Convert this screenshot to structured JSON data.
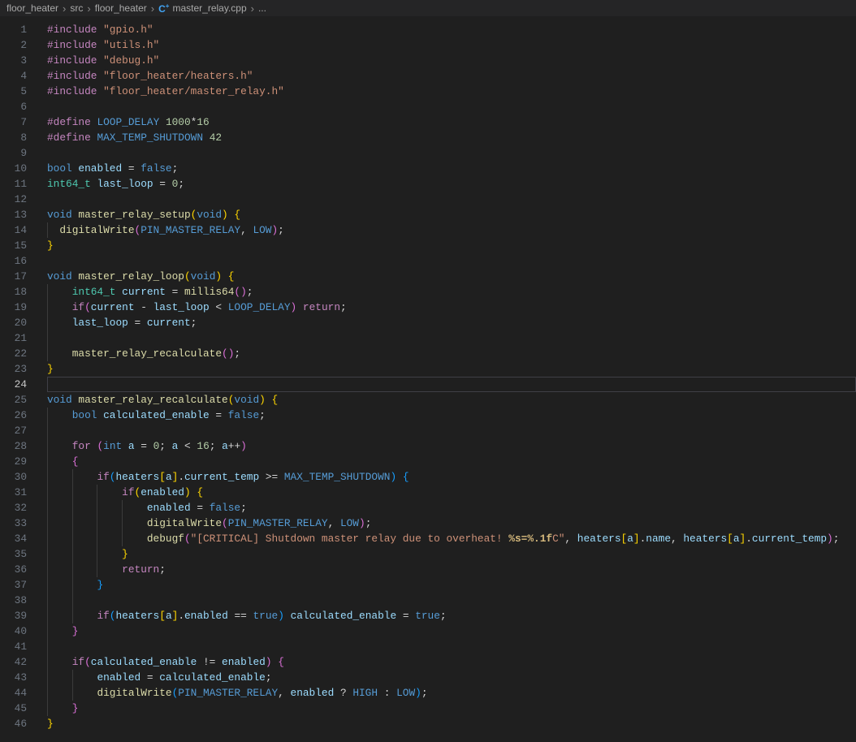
{
  "breadcrumb": {
    "items": [
      "floor_heater",
      "src",
      "floor_heater",
      "master_relay.cpp",
      "..."
    ],
    "separator": "›",
    "file_icon": "cpp-file-icon",
    "file_icon_glyph": "C",
    "file_icon_plus": "+"
  },
  "editor": {
    "file_language": "cpp",
    "active_line": 24,
    "colors": {
      "background": "#1f1f1f",
      "breadcrumb_background": "#252526",
      "line_number": "#6e7681",
      "line_number_active": "#c6c6c6",
      "current_line_border": "#3f3f46",
      "indent_guide": "#3b3b3b",
      "preprocessor_keyword": "#C586C0",
      "keyword_constant": "#569CD6",
      "type": "#4EC9B0",
      "function": "#DCDCAA",
      "variable": "#9CDCFE",
      "string": "#CE9178",
      "number": "#B5CEA8",
      "default_text": "#D4D4D4",
      "bracket_gold": "#FFD700",
      "bracket_pink": "#DA70D6",
      "bracket_blue": "#179FFF",
      "format_specifier": "#D7BA7D",
      "cpp_icon_blue": "#42a5f5"
    },
    "lines": [
      {
        "n": 1,
        "g": [],
        "t": [
          [
            "c",
            "#include"
          ],
          [
            "w",
            " "
          ],
          [
            "s",
            "\"gpio.h\""
          ]
        ]
      },
      {
        "n": 2,
        "g": [],
        "t": [
          [
            "c",
            "#include"
          ],
          [
            "w",
            " "
          ],
          [
            "s",
            "\"utils.h\""
          ]
        ]
      },
      {
        "n": 3,
        "g": [],
        "t": [
          [
            "c",
            "#include"
          ],
          [
            "w",
            " "
          ],
          [
            "s",
            "\"debug.h\""
          ]
        ]
      },
      {
        "n": 4,
        "g": [],
        "t": [
          [
            "c",
            "#include"
          ],
          [
            "w",
            " "
          ],
          [
            "s",
            "\"floor_heater/heaters.h\""
          ]
        ]
      },
      {
        "n": 5,
        "g": [],
        "t": [
          [
            "c",
            "#include"
          ],
          [
            "w",
            " "
          ],
          [
            "s",
            "\"floor_heater/master_relay.h\""
          ]
        ]
      },
      {
        "n": 6,
        "g": [],
        "t": []
      },
      {
        "n": 7,
        "g": [],
        "t": [
          [
            "c",
            "#define"
          ],
          [
            "w",
            " "
          ],
          [
            "k",
            "LOOP_DELAY"
          ],
          [
            "w",
            " "
          ],
          [
            "n",
            "1000"
          ],
          [
            "w",
            "*"
          ],
          [
            "n",
            "16"
          ]
        ]
      },
      {
        "n": 8,
        "g": [],
        "t": [
          [
            "c",
            "#define"
          ],
          [
            "w",
            " "
          ],
          [
            "k",
            "MAX_TEMP_SHUTDOWN"
          ],
          [
            "w",
            " "
          ],
          [
            "n",
            "42"
          ]
        ]
      },
      {
        "n": 9,
        "g": [],
        "t": []
      },
      {
        "n": 10,
        "g": [],
        "t": [
          [
            "k",
            "bool"
          ],
          [
            "w",
            " "
          ],
          [
            "v",
            "enabled"
          ],
          [
            "w",
            " = "
          ],
          [
            "k",
            "false"
          ],
          [
            "w",
            ";"
          ]
        ]
      },
      {
        "n": 11,
        "g": [],
        "t": [
          [
            "t",
            "int64_t"
          ],
          [
            "w",
            " "
          ],
          [
            "v",
            "last_loop"
          ],
          [
            "w",
            " = "
          ],
          [
            "n",
            "0"
          ],
          [
            "w",
            ";"
          ]
        ]
      },
      {
        "n": 12,
        "g": [],
        "t": []
      },
      {
        "n": 13,
        "g": [],
        "t": [
          [
            "k",
            "void"
          ],
          [
            "w",
            " "
          ],
          [
            "f",
            "master_relay_setup"
          ],
          [
            "b1",
            "("
          ],
          [
            "k",
            "void"
          ],
          [
            "b1",
            ")"
          ],
          [
            "w",
            " "
          ],
          [
            "b1",
            "{"
          ]
        ]
      },
      {
        "n": 14,
        "g": [
          0
        ],
        "t": [
          [
            "w",
            "  "
          ],
          [
            "f",
            "digitalWrite"
          ],
          [
            "b2",
            "("
          ],
          [
            "k",
            "PIN_MASTER_RELAY"
          ],
          [
            "w",
            ", "
          ],
          [
            "k",
            "LOW"
          ],
          [
            "b2",
            ")"
          ],
          [
            "w",
            ";"
          ]
        ]
      },
      {
        "n": 15,
        "g": [],
        "t": [
          [
            "b1",
            "}"
          ]
        ]
      },
      {
        "n": 16,
        "g": [],
        "t": []
      },
      {
        "n": 17,
        "g": [],
        "t": [
          [
            "k",
            "void"
          ],
          [
            "w",
            " "
          ],
          [
            "f",
            "master_relay_loop"
          ],
          [
            "b1",
            "("
          ],
          [
            "k",
            "void"
          ],
          [
            "b1",
            ")"
          ],
          [
            "w",
            " "
          ],
          [
            "b1",
            "{"
          ]
        ]
      },
      {
        "n": 18,
        "g": [
          0
        ],
        "t": [
          [
            "w",
            "    "
          ],
          [
            "t",
            "int64_t"
          ],
          [
            "w",
            " "
          ],
          [
            "v",
            "current"
          ],
          [
            "w",
            " = "
          ],
          [
            "f",
            "millis64"
          ],
          [
            "b2",
            "()"
          ],
          [
            "w",
            ";"
          ]
        ]
      },
      {
        "n": 19,
        "g": [
          0
        ],
        "t": [
          [
            "w",
            "    "
          ],
          [
            "c",
            "if"
          ],
          [
            "b2",
            "("
          ],
          [
            "v",
            "current"
          ],
          [
            "w",
            " - "
          ],
          [
            "v",
            "last_loop"
          ],
          [
            "w",
            " < "
          ],
          [
            "k",
            "LOOP_DELAY"
          ],
          [
            "b2",
            ")"
          ],
          [
            "w",
            " "
          ],
          [
            "c",
            "return"
          ],
          [
            "w",
            ";"
          ]
        ]
      },
      {
        "n": 20,
        "g": [
          0
        ],
        "t": [
          [
            "w",
            "    "
          ],
          [
            "v",
            "last_loop"
          ],
          [
            "w",
            " = "
          ],
          [
            "v",
            "current"
          ],
          [
            "w",
            ";"
          ]
        ]
      },
      {
        "n": 21,
        "g": [
          0
        ],
        "t": []
      },
      {
        "n": 22,
        "g": [
          0
        ],
        "t": [
          [
            "w",
            "    "
          ],
          [
            "f",
            "master_relay_recalculate"
          ],
          [
            "b2",
            "()"
          ],
          [
            "w",
            ";"
          ]
        ]
      },
      {
        "n": 23,
        "g": [],
        "t": [
          [
            "b1",
            "}"
          ]
        ]
      },
      {
        "n": 24,
        "g": [],
        "t": []
      },
      {
        "n": 25,
        "g": [],
        "t": [
          [
            "k",
            "void"
          ],
          [
            "w",
            " "
          ],
          [
            "f",
            "master_relay_recalculate"
          ],
          [
            "b1",
            "("
          ],
          [
            "k",
            "void"
          ],
          [
            "b1",
            ")"
          ],
          [
            "w",
            " "
          ],
          [
            "b1",
            "{"
          ]
        ]
      },
      {
        "n": 26,
        "g": [
          0
        ],
        "t": [
          [
            "w",
            "    "
          ],
          [
            "k",
            "bool"
          ],
          [
            "w",
            " "
          ],
          [
            "v",
            "calculated_enable"
          ],
          [
            "w",
            " = "
          ],
          [
            "k",
            "false"
          ],
          [
            "w",
            ";"
          ]
        ]
      },
      {
        "n": 27,
        "g": [
          0
        ],
        "t": []
      },
      {
        "n": 28,
        "g": [
          0
        ],
        "t": [
          [
            "w",
            "    "
          ],
          [
            "c",
            "for"
          ],
          [
            "w",
            " "
          ],
          [
            "b2",
            "("
          ],
          [
            "k",
            "int"
          ],
          [
            "w",
            " "
          ],
          [
            "v",
            "a"
          ],
          [
            "w",
            " = "
          ],
          [
            "n",
            "0"
          ],
          [
            "w",
            "; "
          ],
          [
            "v",
            "a"
          ],
          [
            "w",
            " < "
          ],
          [
            "n",
            "16"
          ],
          [
            "w",
            "; "
          ],
          [
            "v",
            "a"
          ],
          [
            "w",
            "++"
          ],
          [
            "b2",
            ")"
          ]
        ]
      },
      {
        "n": 29,
        "g": [
          0
        ],
        "t": [
          [
            "w",
            "    "
          ],
          [
            "b2",
            "{"
          ]
        ]
      },
      {
        "n": 30,
        "g": [
          0,
          4
        ],
        "t": [
          [
            "w",
            "        "
          ],
          [
            "c",
            "if"
          ],
          [
            "b3",
            "("
          ],
          [
            "v",
            "heaters"
          ],
          [
            "b1",
            "["
          ],
          [
            "v",
            "a"
          ],
          [
            "b1",
            "]"
          ],
          [
            "w",
            "."
          ],
          [
            "v",
            "current_temp"
          ],
          [
            "w",
            " >= "
          ],
          [
            "k",
            "MAX_TEMP_SHUTDOWN"
          ],
          [
            "b3",
            ")"
          ],
          [
            "w",
            " "
          ],
          [
            "b3",
            "{"
          ]
        ]
      },
      {
        "n": 31,
        "g": [
          0,
          4,
          8
        ],
        "t": [
          [
            "w",
            "            "
          ],
          [
            "c",
            "if"
          ],
          [
            "b1",
            "("
          ],
          [
            "v",
            "enabled"
          ],
          [
            "b1",
            ")"
          ],
          [
            "w",
            " "
          ],
          [
            "b1",
            "{"
          ]
        ]
      },
      {
        "n": 32,
        "g": [
          0,
          4,
          8,
          12
        ],
        "t": [
          [
            "w",
            "                "
          ],
          [
            "v",
            "enabled"
          ],
          [
            "w",
            " = "
          ],
          [
            "k",
            "false"
          ],
          [
            "w",
            ";"
          ]
        ]
      },
      {
        "n": 33,
        "g": [
          0,
          4,
          8,
          12
        ],
        "t": [
          [
            "w",
            "                "
          ],
          [
            "f",
            "digitalWrite"
          ],
          [
            "b2",
            "("
          ],
          [
            "k",
            "PIN_MASTER_RELAY"
          ],
          [
            "w",
            ", "
          ],
          [
            "k",
            "LOW"
          ],
          [
            "b2",
            ")"
          ],
          [
            "w",
            ";"
          ]
        ]
      },
      {
        "n": 34,
        "g": [
          0,
          4,
          8,
          12
        ],
        "t": [
          [
            "w",
            "                "
          ],
          [
            "f",
            "debugf"
          ],
          [
            "b2",
            "("
          ],
          [
            "s",
            "\"[CRITICAL] Shutdown master relay due to overheat! "
          ],
          [
            "sp",
            "%s=%.1f"
          ],
          [
            "s",
            "C\""
          ],
          [
            "w",
            ", "
          ],
          [
            "v",
            "heaters"
          ],
          [
            "b1",
            "["
          ],
          [
            "v",
            "a"
          ],
          [
            "b1",
            "]"
          ],
          [
            "w",
            "."
          ],
          [
            "v",
            "name"
          ],
          [
            "w",
            ", "
          ],
          [
            "v",
            "heaters"
          ],
          [
            "b1",
            "["
          ],
          [
            "v",
            "a"
          ],
          [
            "b1",
            "]"
          ],
          [
            "w",
            "."
          ],
          [
            "v",
            "current_temp"
          ],
          [
            "b2",
            ")"
          ],
          [
            "w",
            ";"
          ]
        ]
      },
      {
        "n": 35,
        "g": [
          0,
          4,
          8
        ],
        "t": [
          [
            "w",
            "            "
          ],
          [
            "b1",
            "}"
          ]
        ]
      },
      {
        "n": 36,
        "g": [
          0,
          4,
          8
        ],
        "t": [
          [
            "w",
            "            "
          ],
          [
            "c",
            "return"
          ],
          [
            "w",
            ";"
          ]
        ]
      },
      {
        "n": 37,
        "g": [
          0,
          4
        ],
        "t": [
          [
            "w",
            "        "
          ],
          [
            "b3",
            "}"
          ]
        ]
      },
      {
        "n": 38,
        "g": [
          0,
          4
        ],
        "t": []
      },
      {
        "n": 39,
        "g": [
          0,
          4
        ],
        "t": [
          [
            "w",
            "        "
          ],
          [
            "c",
            "if"
          ],
          [
            "b3",
            "("
          ],
          [
            "v",
            "heaters"
          ],
          [
            "b1",
            "["
          ],
          [
            "v",
            "a"
          ],
          [
            "b1",
            "]"
          ],
          [
            "w",
            "."
          ],
          [
            "v",
            "enabled"
          ],
          [
            "w",
            " == "
          ],
          [
            "k",
            "true"
          ],
          [
            "b3",
            ")"
          ],
          [
            "w",
            " "
          ],
          [
            "v",
            "calculated_enable"
          ],
          [
            "w",
            " = "
          ],
          [
            "k",
            "true"
          ],
          [
            "w",
            ";"
          ]
        ]
      },
      {
        "n": 40,
        "g": [
          0
        ],
        "t": [
          [
            "w",
            "    "
          ],
          [
            "b2",
            "}"
          ]
        ]
      },
      {
        "n": 41,
        "g": [
          0
        ],
        "t": []
      },
      {
        "n": 42,
        "g": [
          0
        ],
        "t": [
          [
            "w",
            "    "
          ],
          [
            "c",
            "if"
          ],
          [
            "b2",
            "("
          ],
          [
            "v",
            "calculated_enable"
          ],
          [
            "w",
            " != "
          ],
          [
            "v",
            "enabled"
          ],
          [
            "b2",
            ")"
          ],
          [
            "w",
            " "
          ],
          [
            "b2",
            "{"
          ]
        ]
      },
      {
        "n": 43,
        "g": [
          0,
          4
        ],
        "t": [
          [
            "w",
            "        "
          ],
          [
            "v",
            "enabled"
          ],
          [
            "w",
            " = "
          ],
          [
            "v",
            "calculated_enable"
          ],
          [
            "w",
            ";"
          ]
        ]
      },
      {
        "n": 44,
        "g": [
          0,
          4
        ],
        "t": [
          [
            "w",
            "        "
          ],
          [
            "f",
            "digitalWrite"
          ],
          [
            "b3",
            "("
          ],
          [
            "k",
            "PIN_MASTER_RELAY"
          ],
          [
            "w",
            ", "
          ],
          [
            "v",
            "enabled"
          ],
          [
            "w",
            " ? "
          ],
          [
            "k",
            "HIGH"
          ],
          [
            "w",
            " : "
          ],
          [
            "k",
            "LOW"
          ],
          [
            "b3",
            ")"
          ],
          [
            "w",
            ";"
          ]
        ]
      },
      {
        "n": 45,
        "g": [
          0
        ],
        "t": [
          [
            "w",
            "    "
          ],
          [
            "b2",
            "}"
          ]
        ]
      },
      {
        "n": 46,
        "g": [],
        "t": [
          [
            "b1",
            "}"
          ]
        ]
      }
    ]
  }
}
